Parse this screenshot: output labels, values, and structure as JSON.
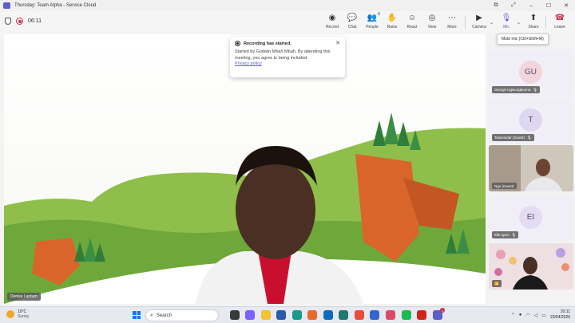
{
  "window": {
    "title": "Thursday: Team Alpha - Service Cloud",
    "controls": [
      "–",
      "☐",
      "✕"
    ],
    "extra_controls": [
      "⧉",
      "⤢"
    ]
  },
  "toolbar": {
    "timer": "06:11",
    "buttons": {
      "record": "Record",
      "chat": "Chat",
      "people": "People",
      "people_count": "6",
      "raise": "Raise",
      "react": "React",
      "view": "View",
      "more": "More",
      "camera": "Camera",
      "mic": "Mic",
      "share": "Share",
      "leave": "Leave"
    },
    "mic_tooltip": "Mute mic (Ctrl+Shift+M)"
  },
  "toast": {
    "title": "Recording has started.",
    "body": "Started by Godwin Mbah Mbah. By attending this meeting, you agree to being included.",
    "link": "Privacy policy"
  },
  "stage": {
    "speaker_name": "Denise Lantum"
  },
  "participants": [
    {
      "name": "George Ugwuogbunna",
      "initials": "GU",
      "avatar_color": "#f2d5dc",
      "muted": true
    },
    {
      "name": "Tasevinder (Guest)",
      "initials": "T",
      "avatar_color": "#ddd8f0",
      "muted": true
    },
    {
      "name": "Ngo (Guest)",
      "initials": "",
      "avatar_color": "",
      "muted": false
    },
    {
      "name": "Elle Igoni",
      "initials": "EI",
      "avatar_color": "#e3dcf2",
      "muted": true
    },
    {
      "name": "",
      "initials": "",
      "avatar_color": "",
      "muted": false
    }
  ],
  "taskbar": {
    "weather_temp": "10°C",
    "weather_desc": "Sunny",
    "search_placeholder": "Search",
    "time": "20:11",
    "date": "23/04/2026",
    "notification_count": "1"
  },
  "colors": {
    "accent": "#5b5fc7",
    "leave": "#c4314b",
    "record": "#c4314b"
  }
}
